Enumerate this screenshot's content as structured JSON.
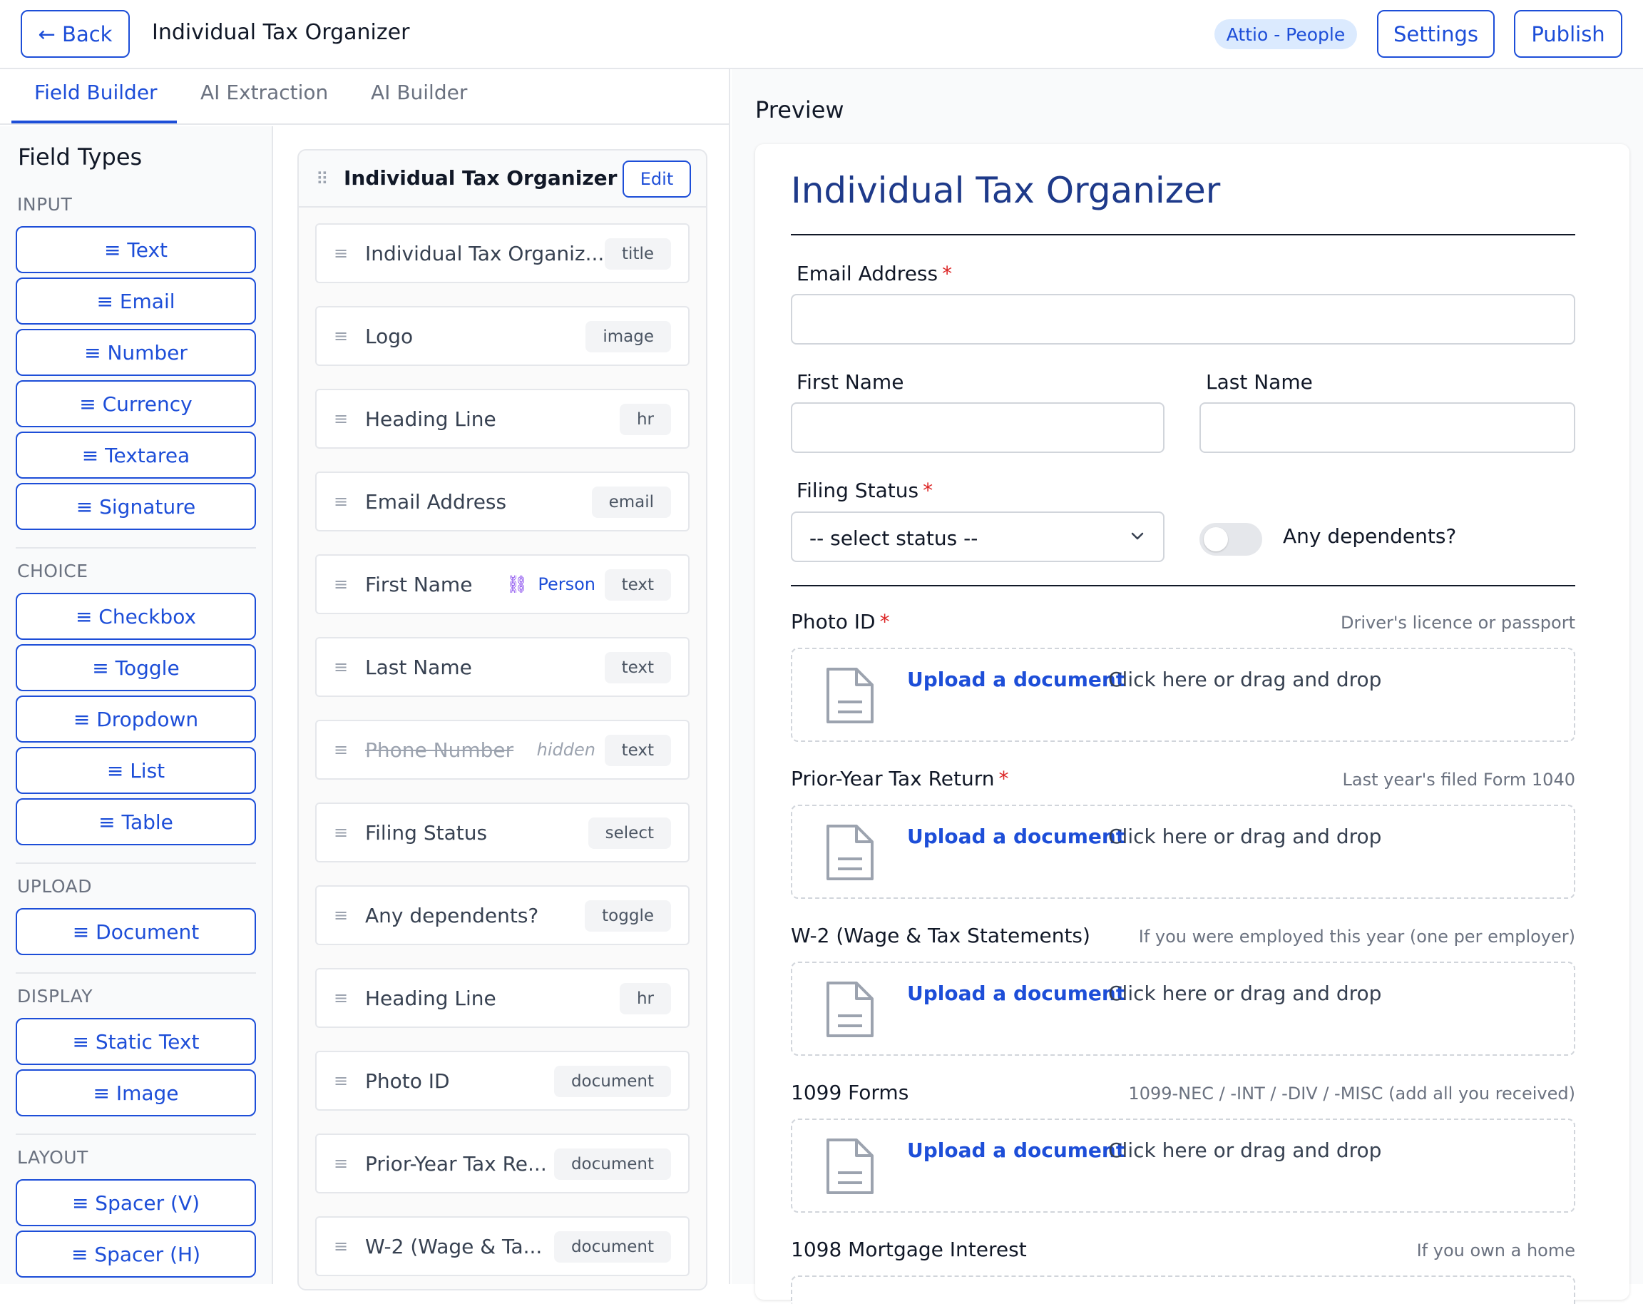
{
  "topbar": {
    "back_label": "← Back",
    "title": "Individual Tax Organizer",
    "integration_badge": "Attio - People",
    "settings_label": "Settings",
    "publish_label": "Publish"
  },
  "tabs": [
    "Field Builder",
    "AI Extraction",
    "AI Builder"
  ],
  "palette": {
    "heading": "Field Types",
    "sections": {
      "input": "INPUT",
      "choice": "CHOICE",
      "upload": "UPLOAD",
      "display": "DISPLAY",
      "layout": "LAYOUT"
    },
    "input_items": [
      "≡ Text",
      "≡ Email",
      "≡ Number",
      "≡ Currency",
      "≡ Textarea",
      "≡ Signature"
    ],
    "choice_items": [
      "≡ Checkbox",
      "≡ Toggle",
      "≡ Dropdown",
      "≡ List",
      "≡ Table"
    ],
    "upload_items": [
      "≡ Document"
    ],
    "display_items": [
      "≡ Static Text",
      "≡ Image"
    ],
    "layout_items": [
      "≡ Spacer (V)",
      "≡ Spacer (H)"
    ]
  },
  "fieldlist": {
    "title": "Individual Tax Organizer",
    "edit_label": "Edit",
    "rows": [
      {
        "label": "Individual Tax Organiz...",
        "type": "title"
      },
      {
        "label": "Logo",
        "type": "image"
      },
      {
        "label": "Heading Line",
        "type": "hr"
      },
      {
        "label": "Email Address",
        "type": "email"
      },
      {
        "label": "First Name",
        "type": "text",
        "link": "Person"
      },
      {
        "label": "Last Name",
        "type": "text"
      },
      {
        "label": "Phone Number",
        "type": "text",
        "hidden": "hidden"
      },
      {
        "label": "Filing Status",
        "type": "select"
      },
      {
        "label": "Any dependents?",
        "type": "toggle"
      },
      {
        "label": "Heading Line",
        "type": "hr"
      },
      {
        "label": "Photo ID",
        "type": "document"
      },
      {
        "label": "Prior-Year Tax Re...",
        "type": "document"
      },
      {
        "label": "W-2 (Wage & Ta...",
        "type": "document"
      }
    ]
  },
  "preview": {
    "heading": "Preview",
    "form_title": "Individual Tax Organizer",
    "email_label": "Email Address",
    "first_name_label": "First Name",
    "last_name_label": "Last Name",
    "filing_status_label": "Filing Status",
    "filing_status_value": "-- select status --",
    "dependents_label": "Any dependents?",
    "required_mark": "*",
    "upload_link": "Upload a document",
    "upload_text": "Click here or drag and drop",
    "uploads": [
      {
        "label": "Photo ID",
        "required": true,
        "hint": "Driver's licence or passport"
      },
      {
        "label": "Prior-Year Tax Return",
        "required": true,
        "hint": "Last year's filed Form 1040"
      },
      {
        "label": "W-2 (Wage & Tax Statements)",
        "required": false,
        "hint": "If you were employed this year (one per employer)"
      },
      {
        "label": "1099 Forms",
        "required": false,
        "hint": "1099-NEC / -INT / -DIV / -MISC (add all you received)"
      },
      {
        "label": "1098 Mortgage Interest",
        "required": false,
        "hint": "If you own a home"
      }
    ]
  },
  "colors": {
    "accent": "#1d4ed8",
    "title_blue": "#1e3a8a",
    "required_red": "#dc2626"
  },
  "icons": {
    "drag": "drag-handle-icon",
    "link": "link-icon",
    "document": "document-icon",
    "chevron": "chevron-down-icon"
  }
}
